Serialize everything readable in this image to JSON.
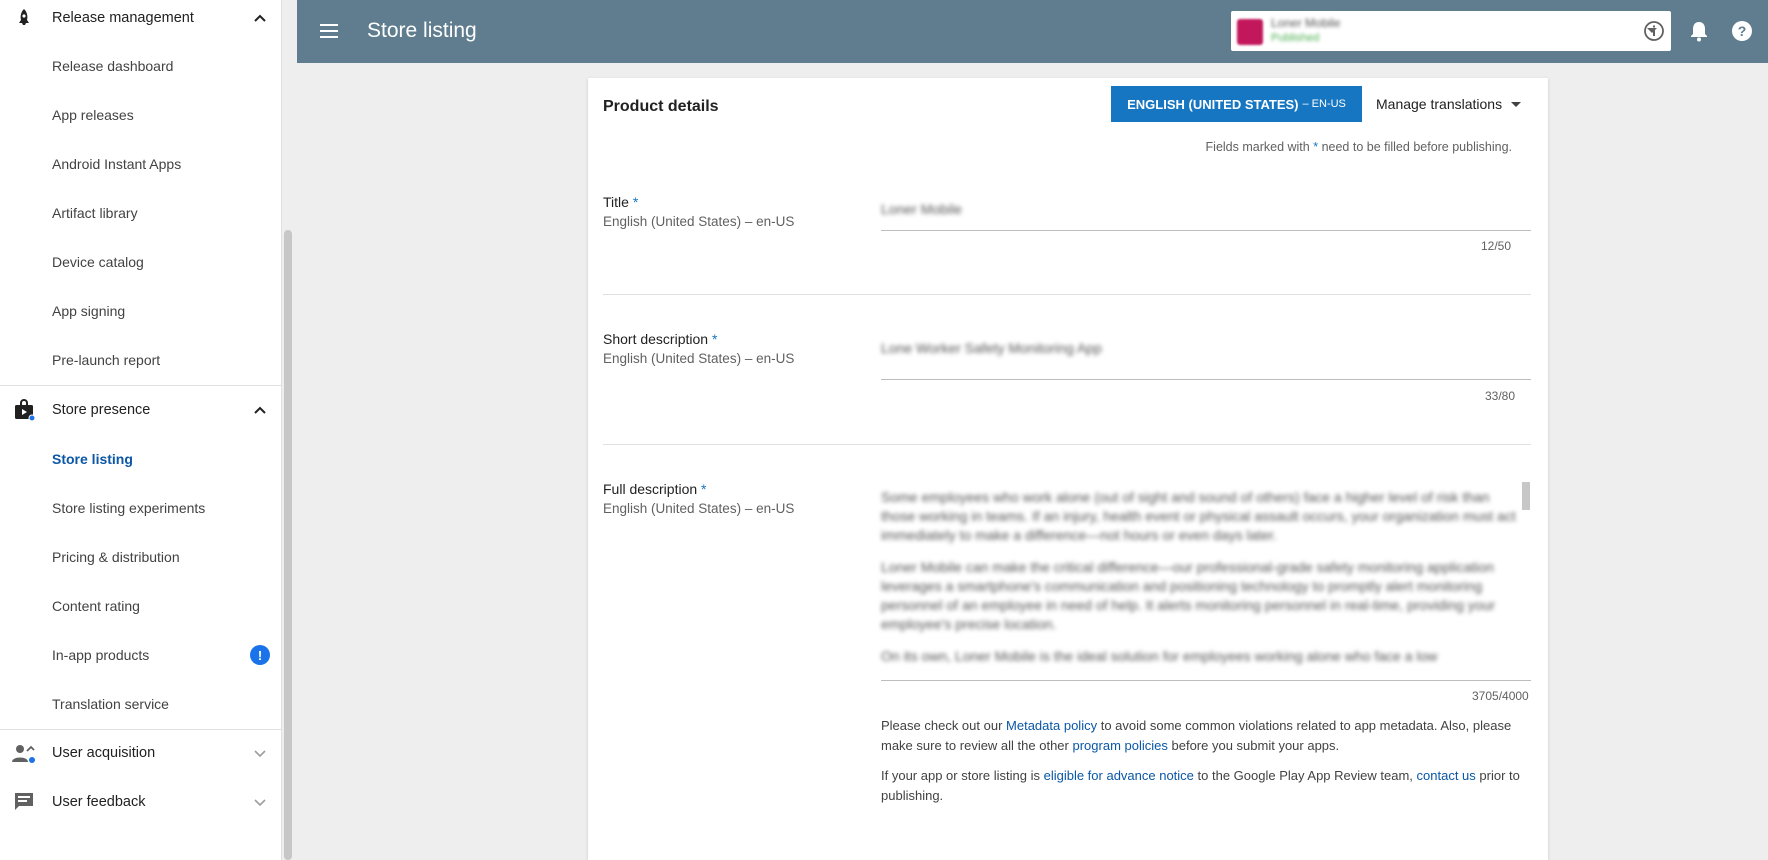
{
  "sidebar": {
    "release_management": {
      "label": "Release management",
      "items": [
        "Release dashboard",
        "App releases",
        "Android Instant Apps",
        "Artifact library",
        "Device catalog",
        "App signing",
        "Pre-launch report"
      ]
    },
    "store_presence": {
      "label": "Store presence",
      "items": [
        "Store listing",
        "Store listing experiments",
        "Pricing & distribution",
        "Content rating",
        "In-app products",
        "Translation service"
      ],
      "active": "Store listing",
      "badge": "!"
    },
    "user_acquisition": {
      "label": "User acquisition"
    },
    "user_feedback": {
      "label": "User feedback"
    }
  },
  "topbar": {
    "title": "Store listing",
    "app_name": "Loner Mobile",
    "app_status": "Published"
  },
  "card": {
    "title": "Product details",
    "language_button": "ENGLISH (UNITED STATES)",
    "language_code": "– EN-US",
    "manage_translations": "Manage translations",
    "required_note_before": "Fields marked with",
    "required_star": "*",
    "required_note_after": "need to be filled before publishing."
  },
  "fields": {
    "title": {
      "label": "Title",
      "lang": "English (United States) – en-US",
      "value": "Loner Mobile",
      "counter": "12/50"
    },
    "short_description": {
      "label": "Short description",
      "lang": "English (United States) – en-US",
      "value": "Lone Worker Safety Monitoring App",
      "counter": "33/80"
    },
    "full_description": {
      "label": "Full description",
      "lang": "English (United States) – en-US",
      "paragraphs": [
        "Some employees who work alone (out of sight and sound of others) face a higher level of risk than those working in teams. If an injury, health event or physical assault occurs, your organization must act immediately to make a difference—not hours or even days later.",
        "Loner Mobile can make the critical difference—our professional-grade safety monitoring application leverages a smartphone's communication and positioning technology to promptly alert monitoring personnel of an employee in need of help. It alerts monitoring personnel in real-time, providing your employee's precise location.",
        "On its own, Loner Mobile is the ideal solution for employees working alone who face a low"
      ],
      "counter": "3705/4000"
    }
  },
  "policy": {
    "p1_a": "Please check out our",
    "p1_link1": "Metadata policy",
    "p1_b": "to avoid some common violations related to app metadata. Also, please make sure to review all the other",
    "p1_link2": "program policies",
    "p1_c": "before you submit your apps.",
    "p2_a": "If your app or store listing is",
    "p2_link1": "eligible for advance notice",
    "p2_b": "to the Google Play App Review team,",
    "p2_link2": "contact us",
    "p2_c": "prior to publishing."
  },
  "colors": {
    "topbar": "#5f7d8e",
    "accent": "#1676c2",
    "link": "#0b57a6",
    "badge": "#1a73e8"
  },
  "icons": {
    "release_management": "rocket-icon",
    "store_presence": "shopping-bag-icon",
    "user_acquisition": "person-add-icon",
    "user_feedback": "feedback-icon",
    "info": "info-icon",
    "notifications": "bell-icon",
    "help": "help-icon"
  }
}
